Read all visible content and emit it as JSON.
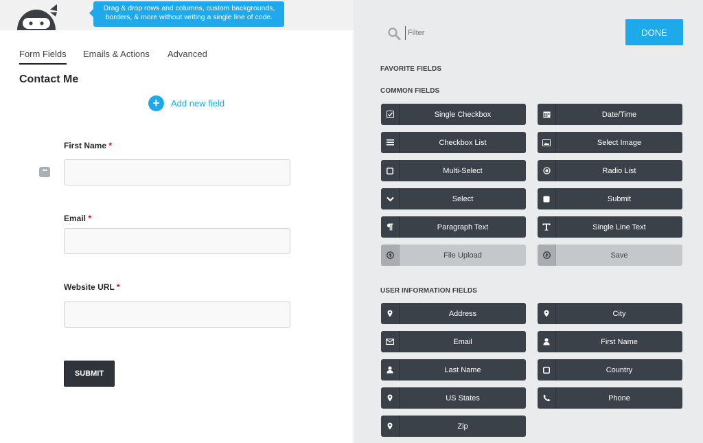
{
  "tooltip": {
    "text": "Drag & drop rows and columns, custom backgrounds, borders, & more without writing a single line of code."
  },
  "tabs": [
    {
      "label": "Form Fields"
    },
    {
      "label": "Emails & Actions"
    },
    {
      "label": "Advanced"
    }
  ],
  "form": {
    "title": "Contact Me",
    "add_field_label": "Add new field",
    "required_marker": "*",
    "fields": [
      {
        "label": "First Name",
        "value": ""
      },
      {
        "label": "Email",
        "value": ""
      },
      {
        "label": "Website URL",
        "value": ""
      }
    ],
    "submit_label": "SUBMIT"
  },
  "drawer": {
    "filter_placeholder": "Filter",
    "done_label": "DONE",
    "sections": {
      "favorite": "FAVORITE FIELDS",
      "common": "COMMON FIELDS",
      "user_info": "USER INFORMATION FIELDS"
    },
    "common_fields": [
      {
        "label": "Single Checkbox",
        "icon": "checkbox-checked-icon"
      },
      {
        "label": "Date/Time",
        "icon": "calendar-icon"
      },
      {
        "label": "Checkbox List",
        "icon": "list-icon"
      },
      {
        "label": "Select Image",
        "icon": "image-icon"
      },
      {
        "label": "Multi-Select",
        "icon": "square-icon"
      },
      {
        "label": "Radio List",
        "icon": "radio-icon"
      },
      {
        "label": "Select",
        "icon": "chevron-down-icon"
      },
      {
        "label": "Submit",
        "icon": "square-filled-icon"
      },
      {
        "label": "Paragraph Text",
        "icon": "paragraph-icon"
      },
      {
        "label": "Single Line Text",
        "icon": "text-icon"
      },
      {
        "label": "File Upload",
        "icon": "upload-icon",
        "disabled": true
      },
      {
        "label": "Save",
        "icon": "upload-icon",
        "disabled": true
      }
    ],
    "user_fields": [
      {
        "label": "Address",
        "icon": "map-pin-icon"
      },
      {
        "label": "City",
        "icon": "map-pin-icon"
      },
      {
        "label": "Email",
        "icon": "envelope-icon"
      },
      {
        "label": "First Name",
        "icon": "user-icon"
      },
      {
        "label": "Last Name",
        "icon": "user-icon"
      },
      {
        "label": "Country",
        "icon": "square-icon"
      },
      {
        "label": "US States",
        "icon": "map-pin-icon"
      },
      {
        "label": "Phone",
        "icon": "phone-icon"
      },
      {
        "label": "Zip",
        "icon": "map-pin-icon"
      }
    ]
  },
  "colors": {
    "accent": "#1ea9ea",
    "button_dark": "#3b4148",
    "required": "#e80000"
  }
}
